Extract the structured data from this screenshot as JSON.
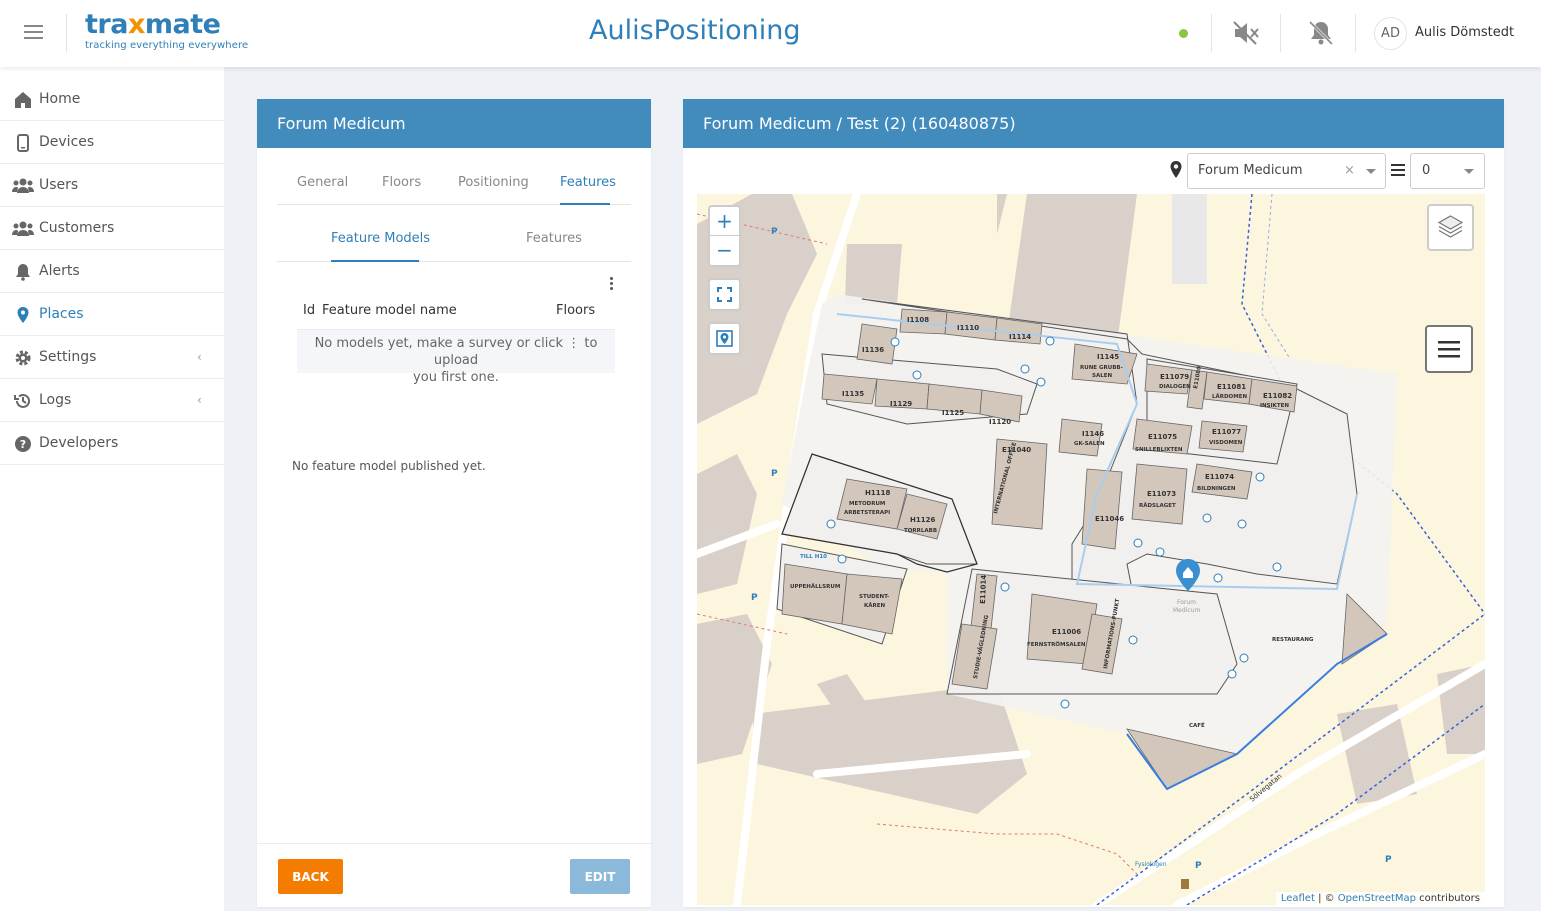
{
  "header": {
    "logo_text_a": "tra",
    "logo_text_x": "x",
    "logo_text_b": "mate",
    "logo_tagline": "tracking everything everywhere",
    "app_title": "AulisPositioning",
    "status_color": "#8cc63f",
    "icons": [
      "menu-icon",
      "volume-mute-icon",
      "bell-off-icon"
    ],
    "user_initials": "AD",
    "user_name": "Aulis Dömstedt"
  },
  "sidebar": {
    "items": [
      {
        "label": "Home",
        "icon": "home-icon"
      },
      {
        "label": "Devices",
        "icon": "phone-icon"
      },
      {
        "label": "Users",
        "icon": "users-icon"
      },
      {
        "label": "Customers",
        "icon": "customers-icon"
      },
      {
        "label": "Alerts",
        "icon": "bell-icon"
      },
      {
        "label": "Places",
        "icon": "map-pin-icon",
        "active": true
      },
      {
        "label": "Settings",
        "icon": "gear-icon",
        "expandable": true
      },
      {
        "label": "Logs",
        "icon": "history-icon",
        "expandable": true
      },
      {
        "label": "Developers",
        "icon": "help-icon"
      }
    ]
  },
  "left_panel": {
    "title": "Forum Medicum",
    "tabs": [
      "General",
      "Floors",
      "Positioning",
      "Features"
    ],
    "active_tab": "Features",
    "subtabs": [
      "Feature Models",
      "Features"
    ],
    "active_subtab": "Feature Models",
    "table": {
      "col_id": "Id",
      "col_name": "Feature model name",
      "col_floors": "Floors",
      "empty_text_1": "No models yet, make a survey or click",
      "empty_icon": "⋮",
      "empty_text_2": "to upload",
      "empty_text_3": "you first one."
    },
    "no_published": "No feature model published yet.",
    "back_label": "BACK",
    "edit_label": "EDIT"
  },
  "right_panel": {
    "title": "Forum Medicum / Test (2) (160480875)",
    "place_select": "Forum Medicum",
    "place_clear": "×",
    "floor_select": "0",
    "map": {
      "zoom_in": "+",
      "zoom_out": "−",
      "rooms": [
        "I1108",
        "I1110",
        "I1114",
        "I1136",
        "I1145",
        "RUNE GRUBB-SALEN",
        "I1135",
        "I1129",
        "I1125",
        "I1120",
        "I1146",
        "GK-SALEN",
        "E11079",
        "DIALOGEN",
        "E11080",
        "EFTERTANKEN",
        "E11081",
        "LÄRDOMEN",
        "E11082",
        "INSIKTEN",
        "E11075",
        "SNILLEBLIXTEN",
        "E11077",
        "VISDOMEN",
        "E11040",
        "INTERNATIONAL OFFICE",
        "H1118",
        "METODRUM ARBETSTERAPI",
        "H1126",
        "TORRLABB",
        "E11074",
        "BILDNINGEN",
        "E11073",
        "RÅDSLAGET",
        "E11046",
        "TILL H10",
        "UPPEHÅLLSRUM",
        "STUDENT-KÅREN",
        "E11014",
        "STUDIE-VÄGLEDNING",
        "E11006",
        "FERNSTRÖMSALEN",
        "INFORMATIONS-PUNKT",
        "RESTAURANG",
        "CAFÉ",
        "Forum Medicum",
        "Sölvegatan",
        "Fysiologen"
      ],
      "attribution_leaflet": "Leaflet",
      "attribution_sep": " | © ",
      "attribution_osm": "OpenStreetMap",
      "attribution_tail": " contributors"
    }
  },
  "colors": {
    "brand_blue": "#2f7fb8",
    "panel_header": "#428bbd",
    "back_button": "#f47c00",
    "edit_button": "#8ab9d9",
    "logo_accent": "#f39200"
  }
}
